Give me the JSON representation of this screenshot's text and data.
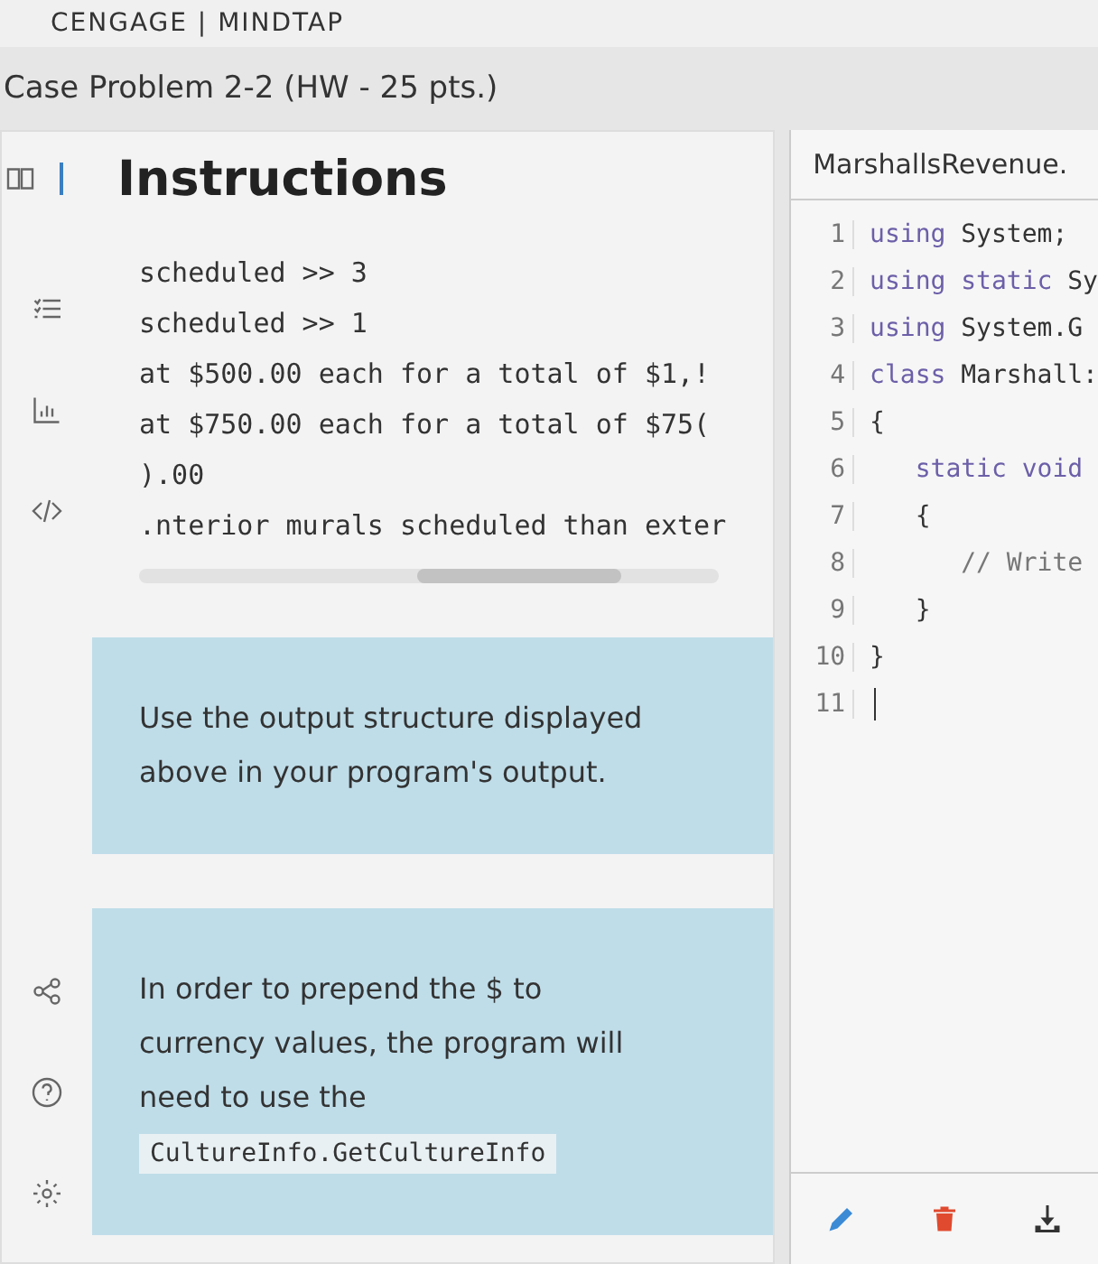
{
  "brand": "CENGAGE | MINDTAP",
  "title": "Case Problem 2-2 (HW - 25 pts.)",
  "instructions": {
    "heading": "Instructions",
    "output_lines": [
      "scheduled >> 3",
      "scheduled >> 1",
      "at $500.00 each for a total of $1,!",
      "at $750.00 each for a total of $75(",
      ").00",
      ".nterior murals scheduled than exter"
    ],
    "notes": [
      {
        "kind": "plain",
        "text": "Use the output structure displayed above in your program's output."
      },
      {
        "kind": "code",
        "text": "In order to prepend the $ to currency values, the program will need to use the",
        "code": "CultureInfo.GetCultureInfo"
      }
    ]
  },
  "sidebar": [
    {
      "kind": "book"
    },
    {
      "kind": "checklist"
    },
    {
      "kind": "chart"
    },
    {
      "kind": "code"
    },
    {
      "kind": "share"
    },
    {
      "kind": "help"
    },
    {
      "kind": "settings"
    }
  ],
  "editor": {
    "tab": "MarshallsRevenue.",
    "lines": [
      {
        "number": "1",
        "tokens": [
          {
            "kind": "keyword",
            "s": "using"
          },
          {
            "kind": "plain",
            "s": "System;"
          }
        ]
      },
      {
        "number": "2",
        "tokens": [
          {
            "kind": "keyword",
            "s": "using static"
          },
          {
            "kind": "plain",
            "s": "Sy"
          }
        ]
      },
      {
        "number": "3",
        "tokens": [
          {
            "kind": "keyword",
            "s": "using"
          },
          {
            "kind": "plain",
            "s": "System.G"
          }
        ]
      },
      {
        "number": "4",
        "tokens": [
          {
            "kind": "keyword",
            "s": "class"
          },
          {
            "kind": "plain",
            "s": "Marshall:"
          }
        ]
      },
      {
        "number": "5",
        "tokens": [
          {
            "kind": "plain",
            "s": "{"
          }
        ]
      },
      {
        "number": "6",
        "tokens": [
          {
            "kind": "keyword",
            "s": "   static void"
          }
        ]
      },
      {
        "number": "7",
        "tokens": [
          {
            "kind": "plain",
            "s": "   {"
          }
        ]
      },
      {
        "number": "8",
        "tokens": [
          {
            "kind": "comment",
            "s": "      // Write"
          }
        ]
      },
      {
        "number": "9",
        "tokens": [
          {
            "kind": "plain",
            "s": "   }"
          }
        ]
      },
      {
        "number": "10",
        "tokens": [
          {
            "kind": "plain",
            "s": "}"
          }
        ]
      },
      {
        "number": "11",
        "cursor": true
      }
    ],
    "actions": [
      {
        "kind": "edit"
      },
      {
        "kind": "delete"
      },
      {
        "kind": "download"
      }
    ]
  }
}
